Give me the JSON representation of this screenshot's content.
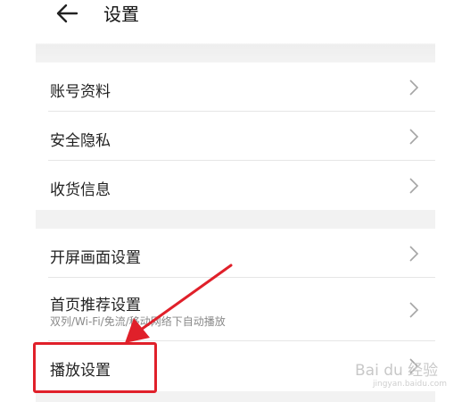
{
  "header": {
    "back_icon": "arrow-left-icon",
    "title": "设置"
  },
  "settings": {
    "account_label": "账号资料",
    "privacy_label": "安全隐私",
    "shipping_label": "收货信息",
    "splash_label": "开屏画面设置",
    "home_recommend_label": "首页推荐设置",
    "home_recommend_sub": "双列/Wi-Fi/免流/移动网络下自动播放",
    "playback_label": "播放设置"
  },
  "chevron_icon": "chevron-right-icon",
  "annotation": {
    "color": "#e0202a",
    "watermark": "Bai du 经验",
    "watermark_sub": "jingyan.baidu.com"
  }
}
